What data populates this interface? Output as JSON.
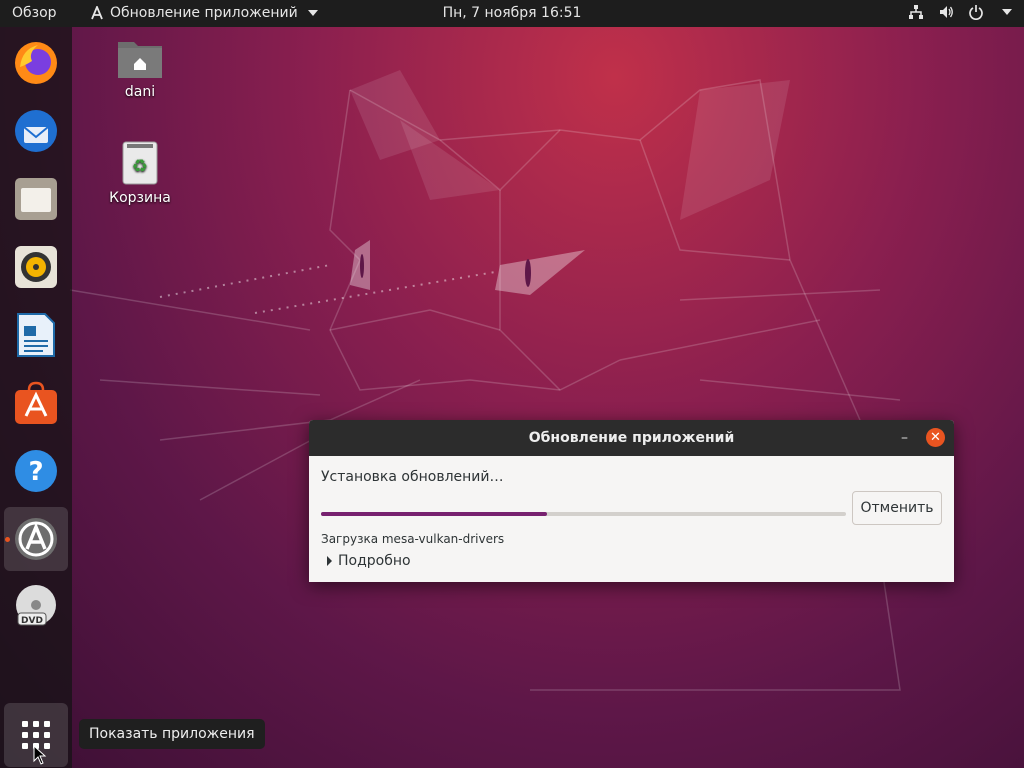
{
  "topbar": {
    "activities": "Обзор",
    "app_menu": "Обновление приложений",
    "clock": "Пн, 7 ноября  16:51",
    "tray_icons": [
      "network-icon",
      "volume-icon",
      "power-icon",
      "chevron-down-icon"
    ]
  },
  "dock": {
    "items": [
      {
        "name": "firefox",
        "icon": "firefox-icon"
      },
      {
        "name": "thunderbird",
        "icon": "thunderbird-icon"
      },
      {
        "name": "files",
        "icon": "files-icon"
      },
      {
        "name": "rhythmbox",
        "icon": "rhythmbox-icon"
      },
      {
        "name": "libreoffice-writer",
        "icon": "writer-icon"
      },
      {
        "name": "ubuntu-software",
        "icon": "software-icon"
      },
      {
        "name": "help",
        "icon": "help-icon"
      },
      {
        "name": "software-updater",
        "icon": "updater-icon",
        "active": true
      },
      {
        "name": "dvd",
        "icon": "dvd-icon"
      }
    ],
    "show_apps_icon": "app-grid-icon",
    "tooltip": "Показать приложения"
  },
  "desktop": {
    "icons": [
      {
        "label": "dani",
        "icon": "home-folder-icon"
      },
      {
        "label": "Корзина",
        "icon": "trash-icon"
      }
    ]
  },
  "dialog": {
    "title": "Обновление приложений",
    "status": "Установка обновлений…",
    "progress": 0.43,
    "package": "Загрузка mesa-vulkan-drivers",
    "cancel_label": "Отменить",
    "details_label": "Подробно",
    "minimize_label": "–",
    "close_label": "✕"
  },
  "colors": {
    "accent": "#e95420",
    "progress": "#77216f",
    "topbar": "#1d1d1d"
  }
}
